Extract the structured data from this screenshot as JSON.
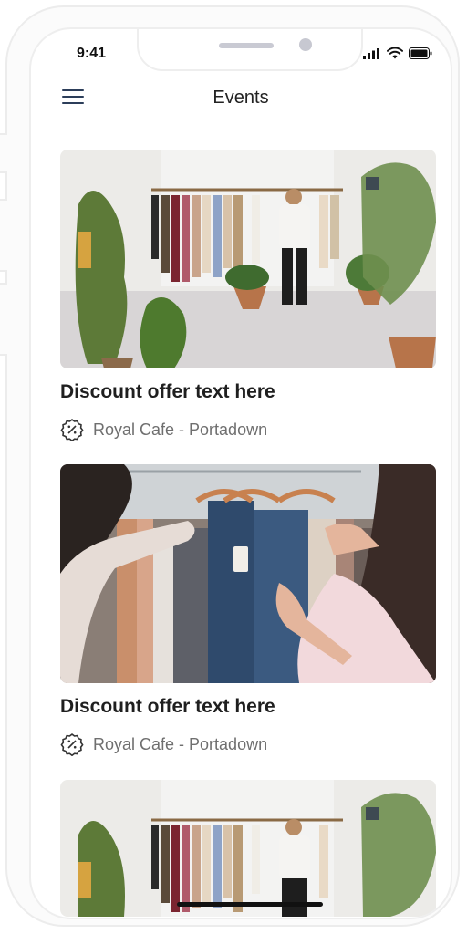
{
  "status_bar": {
    "time": "9:41"
  },
  "header": {
    "title": "Events"
  },
  "events": [
    {
      "title": "Discount offer text here",
      "location": "Royal Cafe - Portadown",
      "image": "clothing-store-photo"
    },
    {
      "title": "Discount offer text here",
      "location": "Royal Cafe - Portadown",
      "image": "shopping-clothes-photo"
    },
    {
      "title": "",
      "location": "",
      "image": "clothing-store-photo"
    }
  ],
  "colors": {
    "menu_icon": "#2c3e5a",
    "text_primary": "#1f1f1f",
    "text_secondary": "#6f6f6f"
  }
}
